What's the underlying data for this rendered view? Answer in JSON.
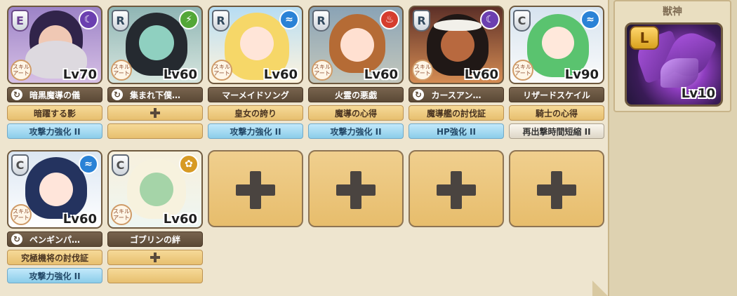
{
  "units": [
    {
      "rarity": "E",
      "element_icon": "dark-element-icon",
      "element_color": "#6b3fb0",
      "skill_badge": "スキル\nアート",
      "level": "Lv70",
      "name": "暗黒魔導の儀",
      "equip": "暗躍する影",
      "skill": "攻撃力強化 II"
    },
    {
      "rarity": "R",
      "element_icon": "wind-element-icon",
      "element_color": "#53a737",
      "skill_badge": "スキル\nアート",
      "level": "Lv60",
      "name": "集まれ下僕…",
      "equip": "",
      "skill": ""
    },
    {
      "rarity": "R",
      "element_icon": "water-element-icon",
      "element_color": "#2a82d6",
      "skill_badge": "スキル\nアート",
      "level": "Lv60",
      "name": "マーメイドソング",
      "equip": "皇女の誇り",
      "skill": "攻撃力強化 II"
    },
    {
      "rarity": "R",
      "element_icon": "fire-element-icon",
      "element_color": "#d53d2e",
      "skill_badge": "スキル\nアート",
      "level": "Lv60",
      "name": "火霊の悪戯",
      "equip": "魔導の心得",
      "skill": "攻撃力強化 II"
    },
    {
      "rarity": "R",
      "element_icon": "dark-element-icon",
      "element_color": "#6b3fb0",
      "skill_badge": "スキル\nアート",
      "level": "Lv60",
      "name": "カースアン…",
      "equip": "魔導艦の討伐証",
      "skill": "HP強化 II"
    },
    {
      "rarity": "C",
      "element_icon": "water-element-icon",
      "element_color": "#2a82d6",
      "skill_badge": "スキル\nアート",
      "level": "Lv90",
      "name": "リザードスケイル",
      "equip": "騎士の心得",
      "skill": "再出撃時間短縮 II"
    },
    {
      "rarity": "C",
      "element_icon": "water-element-icon",
      "element_color": "#2a82d6",
      "skill_badge": "スキル\nアート",
      "level": "Lv60",
      "name": "ペンギンパ…",
      "equip": "究極機将の討伐証",
      "skill": "攻撃力強化 II"
    },
    {
      "rarity": "C",
      "element_icon": "earth-element-icon",
      "element_color": "#d79a24",
      "skill_badge": "スキル\nアート",
      "level": "Lv60",
      "name": "ゴブリンの絆",
      "equip": "",
      "skill": ""
    }
  ],
  "beast": {
    "title": "獣神",
    "rank": "L",
    "level": "Lv10"
  }
}
